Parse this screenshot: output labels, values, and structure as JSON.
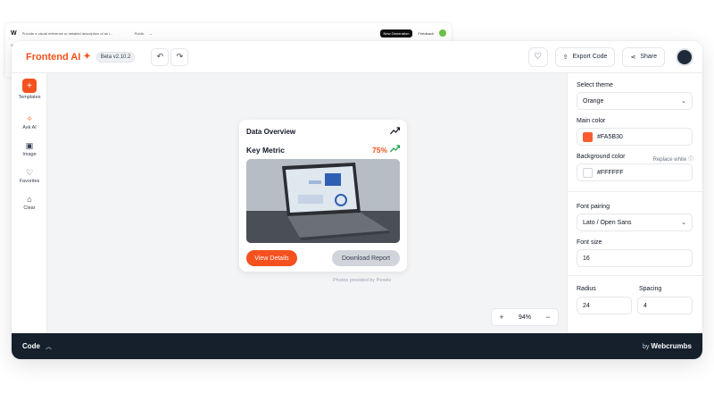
{
  "background_window": {
    "logo": "W",
    "prompt": "Provide a visual reference or detailed description of an i...",
    "visibility": "Public",
    "new_generation": "New Generation",
    "feedback": "Feedback",
    "sub": "New"
  },
  "header": {
    "brand": "Frontend AI",
    "version": "Beta v2.10.2",
    "export_label": "Export Code",
    "share_label": "Share"
  },
  "sidebar": {
    "items": [
      {
        "label": "Templates",
        "icon": "plus-icon"
      },
      {
        "label": "Ask AI",
        "icon": "sparkle-icon"
      },
      {
        "label": "Image",
        "icon": "image-icon"
      },
      {
        "label": "Favorites",
        "icon": "heart-icon"
      },
      {
        "label": "Clear",
        "icon": "trash-icon"
      }
    ]
  },
  "card": {
    "title": "Data Overview",
    "metric_label": "Key Metric",
    "metric_value": "75%",
    "primary_button": "View Details",
    "secondary_button": "Download Report"
  },
  "canvas": {
    "credit": "Photos provided by Pexels",
    "zoom": "94%"
  },
  "panel": {
    "theme_label": "Select theme",
    "theme_value": "Orange",
    "main_color_label": "Main color",
    "main_color_value": "#FA5B30",
    "bg_color_label": "Background color",
    "replace_white": "Replace white",
    "bg_color_value": "#FFFFFF",
    "font_pairing_label": "Font pairing",
    "font_pairing_value": "Lato / Open Sans",
    "font_size_label": "Font size",
    "font_size_value": "16",
    "radius_label": "Radius",
    "radius_value": "24",
    "spacing_label": "Spacing",
    "spacing_value": "4"
  },
  "codebar": {
    "label": "Code",
    "by": "by",
    "brand": "Webcrumbs"
  },
  "colors": {
    "accent": "#f4511e",
    "main_swatch": "#FA5B30",
    "bg_swatch": "#FFFFFF",
    "codebar": "#15202c",
    "trend_green": "#16a34a"
  }
}
